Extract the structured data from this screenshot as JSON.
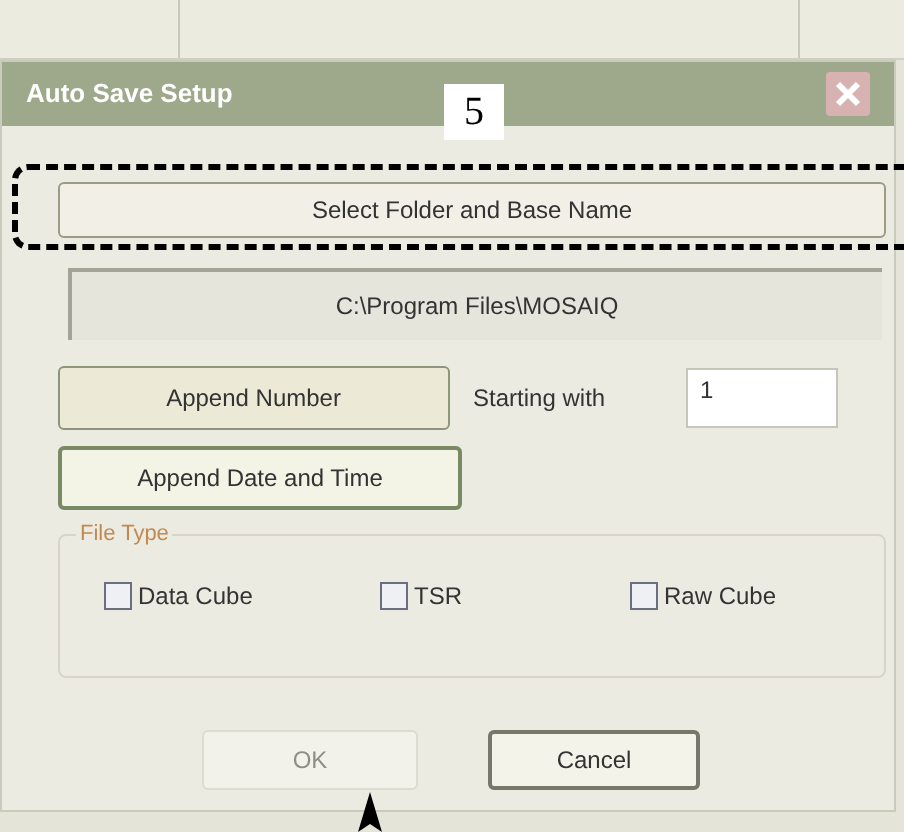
{
  "dialog": {
    "title": "Auto Save Setup"
  },
  "callout": {
    "label": "5"
  },
  "select_button": {
    "label": "Select Folder and Base Name"
  },
  "path": {
    "value": "C:\\Program Files\\MOSAIQ"
  },
  "append_number": {
    "label": "Append Number"
  },
  "starting_with": {
    "label": "Starting with",
    "value": "1"
  },
  "append_date": {
    "label": "Append Date and Time"
  },
  "file_type": {
    "title": "File Type",
    "options": [
      {
        "label": "Data Cube",
        "checked": false
      },
      {
        "label": "TSR",
        "checked": false
      },
      {
        "label": "Raw Cube",
        "checked": false
      }
    ]
  },
  "buttons": [
    {
      "label": "OK",
      "disabled": true
    },
    {
      "label": "Cancel",
      "disabled": false
    }
  ]
}
